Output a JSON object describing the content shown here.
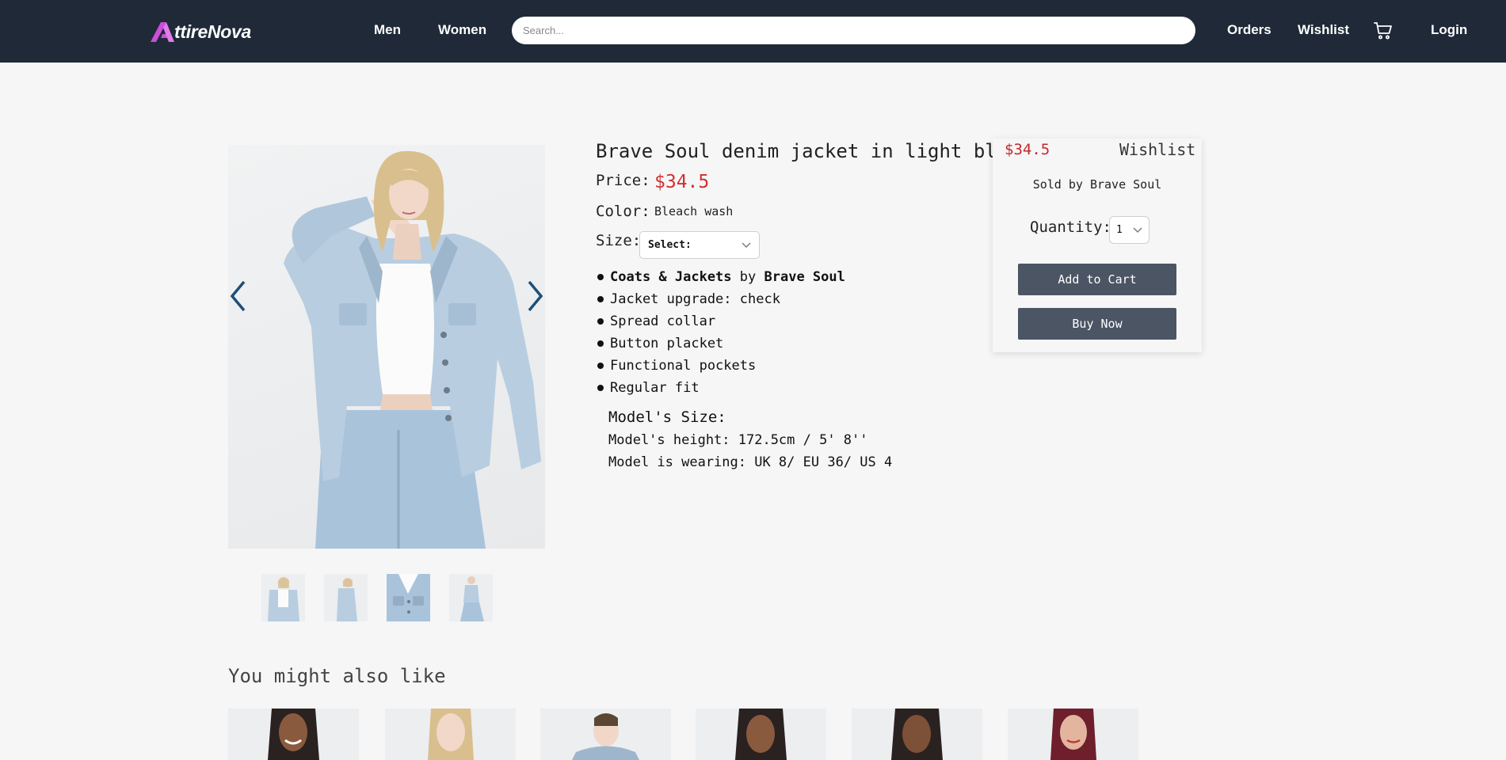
{
  "nav": {
    "logo_text": "ttireNova",
    "links": {
      "men": "Men",
      "women": "Women",
      "orders": "Orders",
      "wishlist": "Wishlist",
      "login": "Login"
    },
    "search_placeholder": "Search...",
    "icons": {
      "cart": "cart-icon",
      "logo": "logo-A-icon"
    },
    "colors": {
      "bar": "#1f2937",
      "logo_accent": "#c94fd8"
    }
  },
  "product": {
    "title": "Brave Soul denim jacket in light blue",
    "price_label": "Price:",
    "price": "$34.5",
    "color_label": "Color:",
    "color_value": "Bleach wash",
    "size_label": "Size:",
    "size_selected": "Select:",
    "category": "Coats & Jackets",
    "by": "by",
    "brand": "Brave Soul",
    "features": [
      "Jacket upgrade: check",
      "Spread collar",
      "Button placket",
      "Functional pockets",
      "Regular fit"
    ],
    "model_heading": "Model's Size:",
    "model_height": "Model's height: 172.5cm / 5' 8''",
    "model_wearing": "Model is wearing: UK 8/ EU 36/ US 4"
  },
  "buy_box": {
    "price": "$34.5",
    "wishlist": "Wishlist",
    "sold_by": "Sold by Brave Soul",
    "quantity_label": "Quantity:",
    "quantity_value": "1",
    "add_to_cart": "Add to Cart",
    "buy_now": "Buy Now",
    "colors": {
      "price": "#c62828",
      "button": "#4b5563"
    }
  },
  "gallery": {
    "thumbnail_count": 4,
    "icons": {
      "prev": "chevron-left-icon",
      "next": "chevron-right-icon"
    }
  },
  "recommendations": {
    "heading": "You might also like",
    "item_count": 6
  }
}
